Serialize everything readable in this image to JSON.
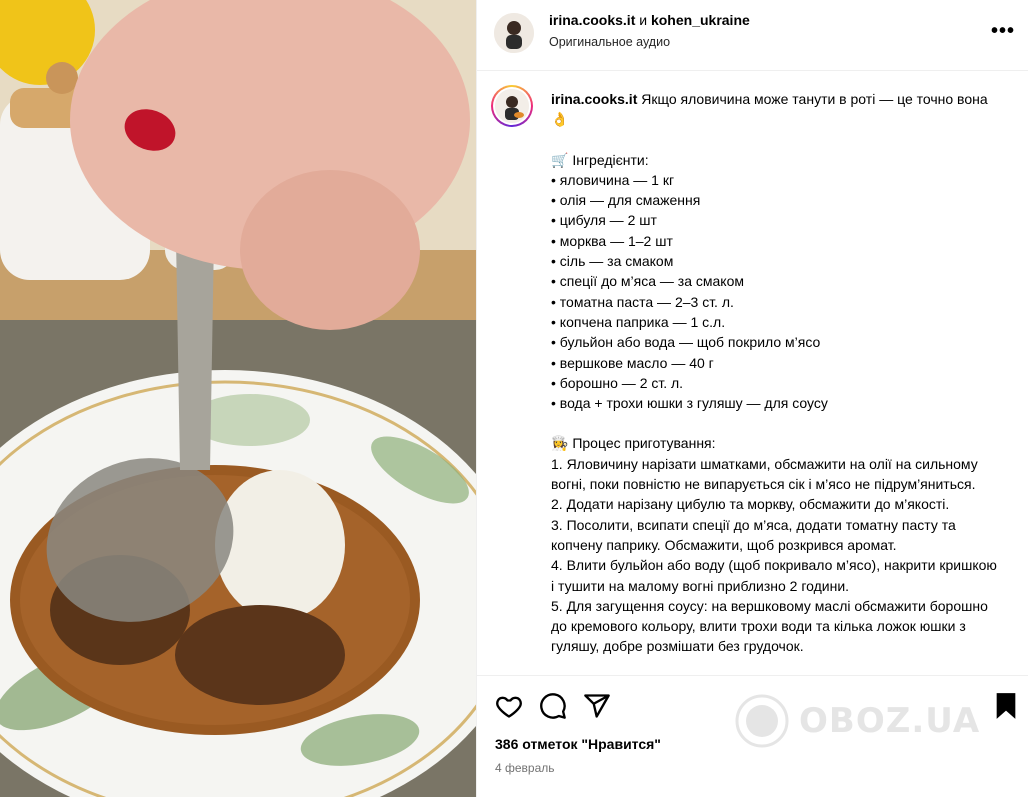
{
  "header": {
    "user1": "irina.cooks.it",
    "joiner": "и",
    "user2": "kohen_ukraine",
    "audio": "Оригинальное аудио",
    "more_icon": "more-horizontal-icon"
  },
  "caption": {
    "username": "irina.cooks.it",
    "intro": "Якщо яловичина може танути в роті — це точно вона 👌",
    "ingredients_title": "🛒 Інгредієнти:",
    "ingredients": [
      "• яловичина — 1 кг",
      "• олія — для смаження",
      "• цибуля — 2 шт",
      "• морква — 1–2 шт",
      "• сіль — за смаком",
      "• спеції до м’яса — за смаком",
      "• томатна паста — 2–3 ст. л.",
      "• копчена паприка — 1 с.л.",
      "• бульйон або вода — щоб покрило м’ясо",
      "• вершкове масло — 40 г",
      "• борошно — 2 ст. л.",
      "• вода + трохи юшки з гуляшу — для соусу"
    ],
    "process_title": "👩‍🍳 Процес приготування:",
    "steps": [
      "1. Яловичину нарізати шматками, обсмажити на олії на сильному вогні, поки повністю не випарується сік і м’ясо не підрум’яниться.",
      "2. Додати нарізану цибулю та моркву, обсмажити до м’якості.",
      "3. Посолити, всипати спеції до м’яса, додати томатну пасту та копчену паприку. Обсмажити, щоб розкрився аромат.",
      "4. Влити бульйон або воду (щоб покривало м’ясо), накрити кришкою і тушити на малому вогні приблизно 2 години.",
      "5. Для загущення соусу: на вершковому маслі обсмажити борошно до кремового кольору, влити трохи води та кілька ложок юшки з гуляшу, добре розмішати без грудочок."
    ]
  },
  "actions": {
    "likes": "386 отметок \"Нравится\"",
    "date": "4 февраль",
    "icons": [
      "heart-icon",
      "comment-icon",
      "share-icon",
      "bookmark-icon"
    ]
  },
  "watermark": {
    "text": "OBOZ.UA"
  }
}
